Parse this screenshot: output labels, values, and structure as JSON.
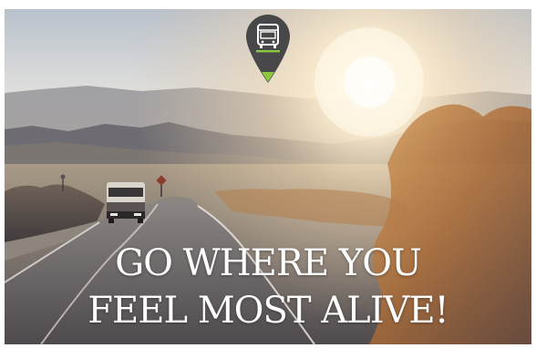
{
  "photo": {
    "subject": "rv-on-desert-road",
    "colors": {
      "sky_top": "#bcc4cf",
      "sun": "#fff3d6",
      "mountains": "#6b6a6f",
      "road": "#5f5b5c",
      "shrub": "#b8793e",
      "pin": "#3f3f43",
      "pin_accent": "#8ac640"
    }
  },
  "pin_icon": "rv-location-pin-icon",
  "headline": {
    "line1": "GO WHERE YOU",
    "line2": "FEEL MOST ALIVE!"
  }
}
